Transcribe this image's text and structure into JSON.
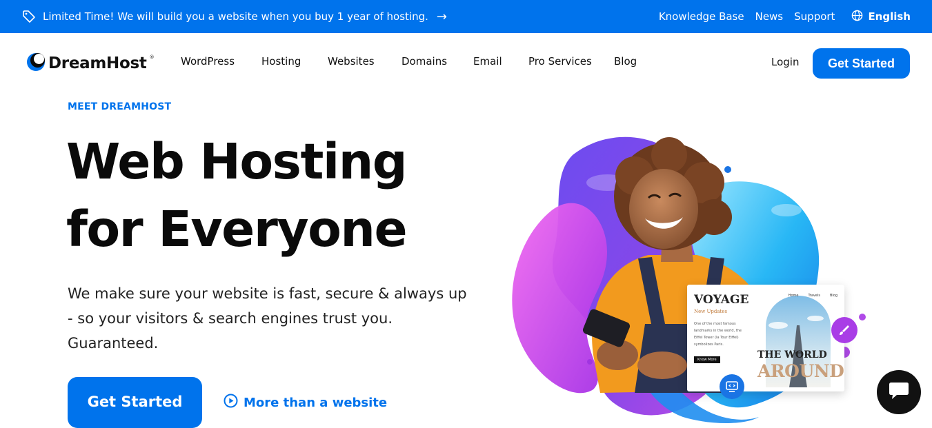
{
  "promo": {
    "message": "Limited Time! We will build you a website when you buy 1 year of hosting.",
    "links": [
      "Knowledge Base",
      "News",
      "Support"
    ],
    "language": "English"
  },
  "nav": {
    "logo": "DreamHost",
    "logo_mark": "®",
    "items": [
      "WordPress",
      "Hosting",
      "Websites",
      "Domains",
      "Email",
      "Pro Services",
      "Blog"
    ],
    "login": "Login",
    "cta": "Get Started"
  },
  "hero": {
    "eyebrow": "MEET DREAMHOST",
    "title_line1": "Web Hosting",
    "title_line2": "for Everyone",
    "subtitle": "We make sure your website is fast, secure & always up - so your visitors & search engines trust you. Guaranteed.",
    "cta": "Get Started",
    "secondary": "More than a website"
  },
  "mockup": {
    "title": "VOYAGE",
    "subtitle": "New Updates",
    "text": "One of the most famous landmarks in the world, the Eiffel Tower (la Tour Eiffel) symbolizes Paris.",
    "button": "Know More",
    "nav": [
      "Home",
      "Travels",
      "Blog"
    ],
    "headline_top": "THE WORLD",
    "headline_bottom": "AROUND"
  },
  "colors": {
    "accent": "#0073ec",
    "chat_bg": "#111111"
  },
  "icons": {
    "promo": "tag-icon",
    "language": "globe-icon",
    "more": "play-circle-icon",
    "chat": "chat-bubble-icon"
  }
}
